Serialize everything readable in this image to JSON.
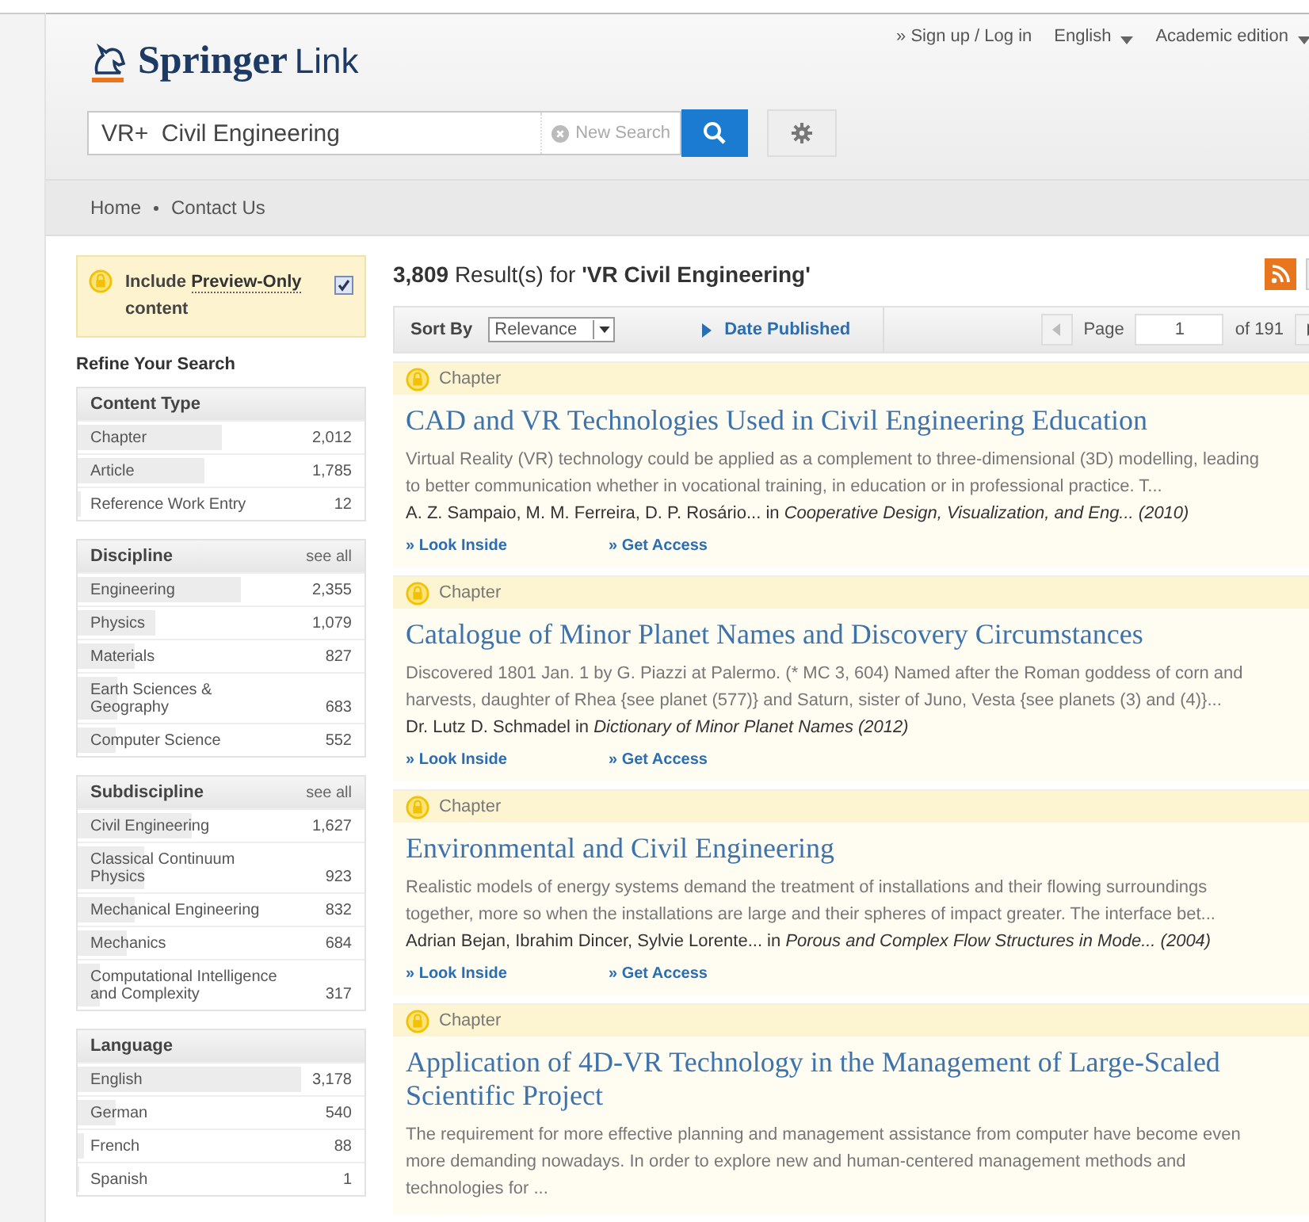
{
  "header": {
    "logo": {
      "brand": "Springer",
      "product": "Link"
    },
    "links": [
      {
        "label": "» Sign up / Log in",
        "kind": "link"
      },
      {
        "label": "English",
        "kind": "menu"
      },
      {
        "label": "Academic edition",
        "kind": "menu"
      }
    ],
    "search": {
      "value": "VR+  Civil Engineering",
      "clear_label": "New Search"
    }
  },
  "nav": [
    "Home",
    "Contact Us"
  ],
  "preview": {
    "label_before": "Include ",
    "label_link": "Preview-Only",
    "label_after": "content",
    "checked": true
  },
  "refine_title": "Refine Your Search",
  "facets": [
    {
      "title": "Content Type",
      "items": [
        {
          "name": "Chapter",
          "count": "2,012",
          "level": 0.5
        },
        {
          "name": "Article",
          "count": "1,785",
          "level": 0.44
        },
        {
          "name": "Reference Work Entry",
          "count": "12",
          "level": 0.01
        }
      ]
    },
    {
      "title": "Discipline",
      "see_all": "see all",
      "items": [
        {
          "name": "Engineering",
          "count": "2,355",
          "level": 0.57
        },
        {
          "name": "Physics",
          "count": "1,079",
          "level": 0.27
        },
        {
          "name": "Materials",
          "count": "827",
          "level": 0.2
        },
        {
          "name": "Earth Sciences & Geography",
          "count": "683",
          "level": 0.14
        },
        {
          "name": "Computer Science",
          "count": "552",
          "level": 0.13
        }
      ]
    },
    {
      "title": "Subdiscipline",
      "see_all": "see all",
      "items": [
        {
          "name": "Civil Engineering",
          "count": "1,627",
          "level": 0.4
        },
        {
          "name": "Classical Continuum Physics",
          "count": "923",
          "level": 0.23
        },
        {
          "name": "Mechanical Engineering",
          "count": "832",
          "level": 0.2
        },
        {
          "name": "Mechanics",
          "count": "684",
          "level": 0.17
        },
        {
          "name": "Computational Intelligence and Complexity",
          "count": "317",
          "level": 0.08
        }
      ]
    },
    {
      "title": "Language",
      "items": [
        {
          "name": "English",
          "count": "3,178",
          "level": 0.78
        },
        {
          "name": "German",
          "count": "540",
          "level": 0.13
        },
        {
          "name": "French",
          "count": "88",
          "level": 0.02
        },
        {
          "name": "Spanish",
          "count": "1",
          "level": 0.005
        }
      ]
    }
  ],
  "results_header": {
    "count": "3,809",
    "text": "Result(s) for",
    "query": "'VR Civil Engineering'"
  },
  "sort": {
    "label": "Sort By",
    "value": "Relevance",
    "alt": "Date Published"
  },
  "pager": {
    "label": "Page",
    "value": "1",
    "of": "of 191"
  },
  "results": [
    {
      "type": "Chapter",
      "title": "CAD and VR Technologies Used in Civil Engineering Education",
      "abstract": "Virtual Reality (VR) technology could be applied as a complement to three-dimensional (3D) modelling, leading to better communication whether in vocational training, in education or in professional practice. T...",
      "authors": "A. Z. Sampaio, M. M. Ferreira, D. P. Rosário... in *Cooperative Design, Visualization, and Eng... (2010)*",
      "links": [
        "» Look Inside",
        "» Get Access"
      ]
    },
    {
      "type": "Chapter",
      "title": "Catalogue of Minor Planet Names and Discovery Circumstances",
      "abstract": "Discovered 1801 Jan. 1 by G. Piazzi at Palermo. (* MC 3, 604) Named after the Roman goddess of corn and harvests, daughter of Rhea {see planet (577)} and Saturn, sister of Juno, Vesta {see planets (3) and (4)}...",
      "authors": "Dr. Lutz D. Schmadel in *Dictionary of Minor Planet Names (2012)*",
      "links": [
        "» Look Inside",
        "» Get Access"
      ]
    },
    {
      "type": "Chapter",
      "title": "Environmental and Civil Engineering",
      "abstract": "Realistic models of energy systems demand the treatment of installations and their flowing surroundings together, more so when the installations are large and their spheres of impact greater. The interface bet...",
      "authors": "Adrian Bejan, Ibrahim Dincer, Sylvie Lorente... in *Porous and Complex Flow Structures in Mode... (2004)*",
      "links": [
        "» Look Inside",
        "» Get Access"
      ]
    },
    {
      "type": "Chapter",
      "title": "Application of 4D-VR Technology in the Management of Large-Scaled Scientific Project",
      "abstract": "The requirement for more effective planning and management assistance from computer have become even more demanding nowadays. In order to explore new and human-centered management methods and technologies for ..."
    }
  ]
}
